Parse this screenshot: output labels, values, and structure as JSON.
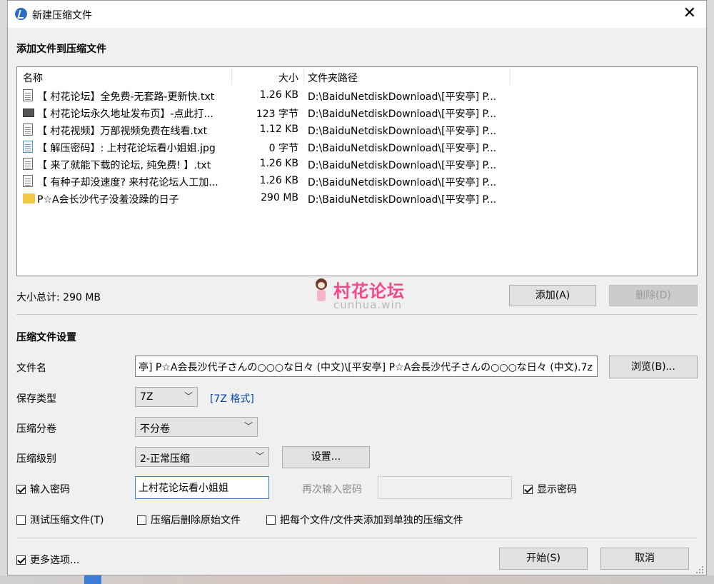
{
  "window": {
    "title": "新建压缩文件",
    "close_glyph": "✕"
  },
  "add_section": {
    "title": "添加文件到压缩文件"
  },
  "file_list": {
    "columns": [
      "名称",
      "大小",
      "文件夹路径"
    ],
    "rows": [
      {
        "icon": "text-file-icon",
        "name": "【 村花论坛】全免费-无套路-更新快.txt",
        "size": "1.26 KB",
        "path": "D:\\BaiduNetdiskDownload\\[平安亭] P..."
      },
      {
        "icon": "shortcut-icon",
        "name": "【 村花论坛永久地址发布页】-点此打...",
        "size": "123 字节",
        "path": "D:\\BaiduNetdiskDownload\\[平安亭] P..."
      },
      {
        "icon": "text-file-icon",
        "name": "【 村花视频】万部视频免费在线看.txt",
        "size": "1.12 KB",
        "path": "D:\\BaiduNetdiskDownload\\[平安亭] P..."
      },
      {
        "icon": "image-file-icon",
        "name": "【 解压密码】: 上村花论坛看小姐姐.jpg",
        "size": "0 字节",
        "path": "D:\\BaiduNetdiskDownload\\[平安亭] P..."
      },
      {
        "icon": "text-file-icon",
        "name": "【 来了就能下载的论坛, 纯免费! 】.txt",
        "size": "1.26 KB",
        "path": "D:\\BaiduNetdiskDownload\\[平安亭] P..."
      },
      {
        "icon": "text-file-icon",
        "name": "【 有种子却没速度? 来村花论坛人工加...",
        "size": "1.26 KB",
        "path": "D:\\BaiduNetdiskDownload\\[平安亭] P..."
      },
      {
        "icon": "folder-icon",
        "name": "P☆A会长沙代子没羞没躁的日子",
        "size": "290 MB",
        "path": "D:\\BaiduNetdiskDownload\\[平安亭] P..."
      }
    ]
  },
  "total_size": "大小总计: 290 MB",
  "buttons": {
    "add": "添加(A)",
    "delete": "删除(D)",
    "browse": "浏览(B)...",
    "settings": "设置...",
    "start": "开始(S)",
    "cancel": "取消"
  },
  "watermark": {
    "title": "村花论坛",
    "subtitle": "cunhua.win"
  },
  "settings_section": {
    "title": "压缩文件设置"
  },
  "fields": {
    "filename_label": "文件名",
    "filename_value": "亭] P☆A会長沙代子さんの○○○な日々 (中文)\\[平安亭] P☆A会長沙代子さんの○○○な日々 (中文).7z",
    "save_type_label": "保存类型",
    "save_type_value": "7Z",
    "save_type_link": "[7Z 格式]",
    "split_label": "压缩分卷",
    "split_value": "不分卷",
    "level_label": "压缩级别",
    "level_value": "2-正常压缩",
    "password_label": "输入密码",
    "password_value": "上村花论坛看小姐姐",
    "confirm_password_label": "再次输入密码",
    "confirm_password_value": "",
    "show_password_label": "显示密码"
  },
  "checkboxes": {
    "test": "测试压缩文件(T)",
    "delete_after": "压缩后删除原始文件",
    "separate": "把每个文件/文件夹添加到单独的压缩文件",
    "more_options": "更多选项..."
  }
}
